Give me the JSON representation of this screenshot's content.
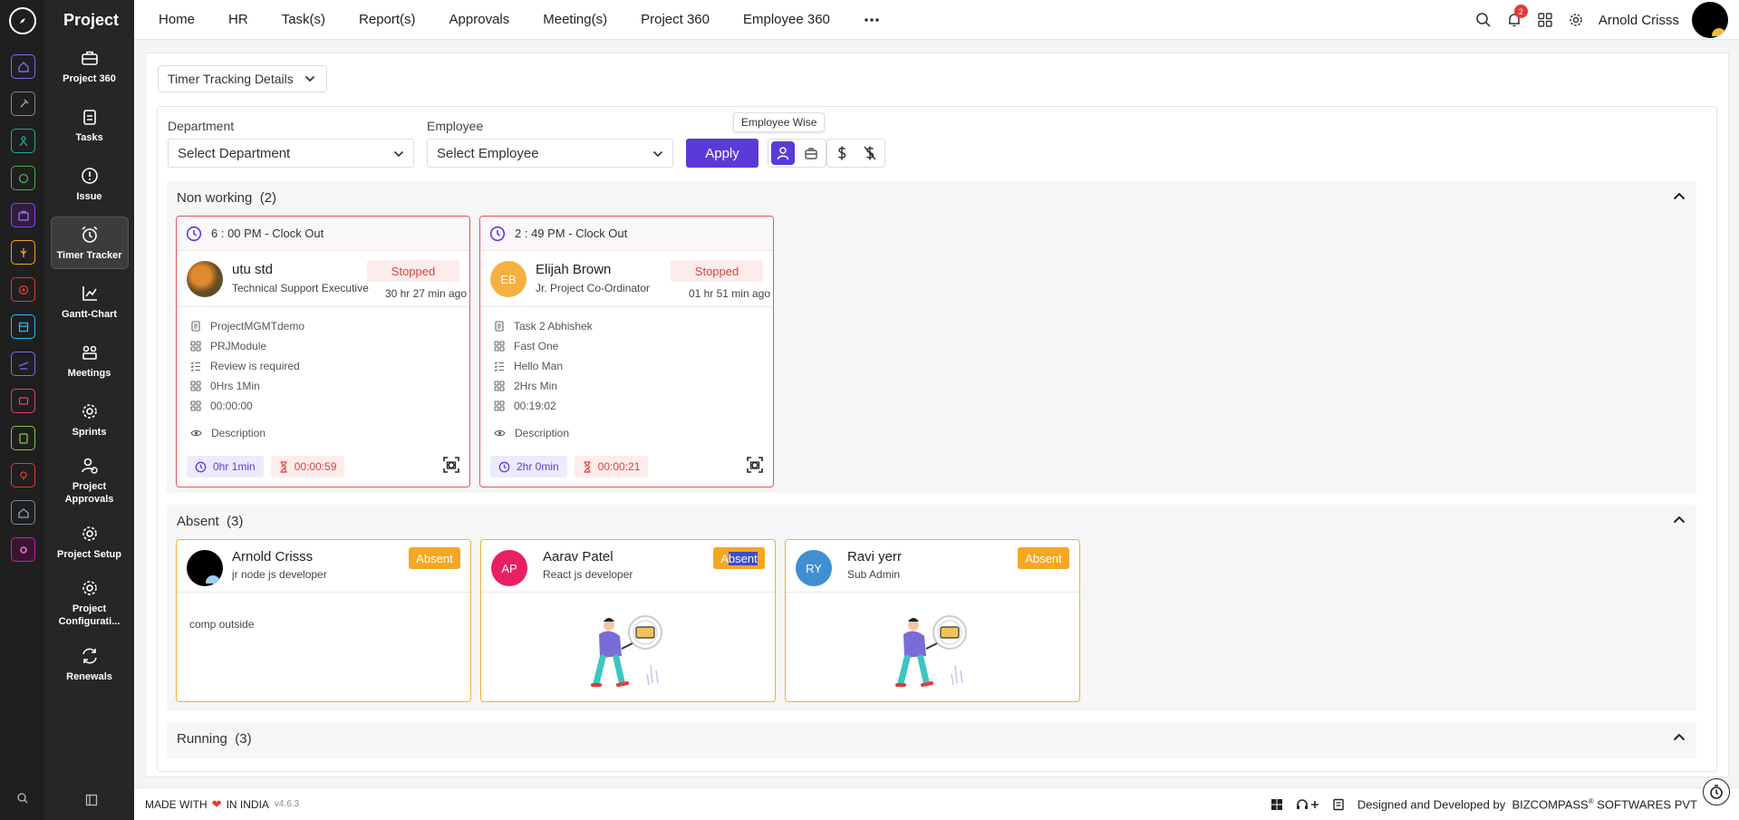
{
  "sidebar": {
    "brand": "Project",
    "items": [
      {
        "label": "Project 360",
        "icon": "briefcase-icon"
      },
      {
        "label": "Tasks",
        "icon": "clipboard-icon"
      },
      {
        "label": "Issue",
        "icon": "alert-circle-icon"
      },
      {
        "label": "Timer Tracker",
        "icon": "alarm-clock-icon",
        "active": true
      },
      {
        "label": "Gantt-Chart",
        "icon": "gantt-chart-icon"
      },
      {
        "label": "Meetings",
        "icon": "meetings-icon"
      },
      {
        "label": "Sprints",
        "icon": "gear-icon"
      },
      {
        "label": "Project Approvals",
        "icon": "user-check-icon"
      },
      {
        "label": "Project Setup",
        "icon": "gear-icon"
      },
      {
        "label": "Project Configurati...",
        "icon": "gear-icon"
      },
      {
        "label": "Renewals",
        "icon": "refresh-icon"
      }
    ]
  },
  "nav": {
    "items": [
      "Home",
      "HR",
      "Task(s)",
      "Report(s)",
      "Approvals",
      "Meeting(s)",
      "Project 360",
      "Employee 360"
    ]
  },
  "topbar": {
    "notification_count": "2",
    "user_name": "Arnold Crisss"
  },
  "main": {
    "view_dropdown": "Timer Tracking Details",
    "filters": {
      "department_label": "Department",
      "department_value": "Select Department",
      "employee_label": "Employee",
      "employee_value": "Select Employee",
      "apply_label": "Apply",
      "tooltip": "Employee Wise"
    },
    "sections": {
      "non_working": {
        "title": "Non working",
        "count": "(2)",
        "cards": [
          {
            "clock_out": "6 : 00 PM - Clock Out",
            "name": "utu std",
            "role": "Technical Support Executive",
            "status": "Stopped",
            "ago": "30 hr 27 min ago",
            "project": "ProjectMGMTdemo",
            "module": "PRJModule",
            "task": "Review is required",
            "estimate": "0Hrs 1Min",
            "logged": "00:00:00",
            "description": "Description",
            "total_time": "0hr 1min",
            "timer": "00:00:59"
          },
          {
            "clock_out": "2 : 49 PM - Clock Out",
            "initials": "EB",
            "name": "Elijah Brown",
            "role": "Jr. Project Co-Ordinator",
            "status": "Stopped",
            "ago": "01 hr 51 min ago",
            "project": "Task 2 Abhishek",
            "module": "Fast One",
            "task": "Hello Man",
            "estimate": "2Hrs Min",
            "logged": "00:19:02",
            "description": "Description",
            "total_time": "2hr 0min",
            "timer": "00:00:21"
          }
        ]
      },
      "absent": {
        "title": "Absent",
        "count": "(3)",
        "cards": [
          {
            "name": "Arnold Crisss",
            "role": "jr node js developer",
            "status": "Absent",
            "note": "comp outside"
          },
          {
            "initials": "AP",
            "name": "Aarav Patel",
            "role": "React js developer",
            "status_pre": "A",
            "status_hl": "bsent"
          },
          {
            "initials": "RY",
            "name": "Ravi yerr",
            "role": "Sub Admin",
            "status": "Absent"
          }
        ]
      },
      "running": {
        "title": "Running",
        "count": "(3)"
      }
    }
  },
  "footer": {
    "made_with": "MADE WITH",
    "in_india": "IN INDIA",
    "version": "v4.6.3",
    "credit_prefix": "Designed and Developed by",
    "company": "BIZCOMPASS",
    "reg": "®",
    "company_suffix": " SOFTWARES PVT"
  },
  "colors": {
    "accent": "#5b3bd6",
    "stopped_border": "#e15656",
    "absent_border": "#f0b042",
    "absent_badge": "#f5a623",
    "avatar_eb": "#f5b041",
    "avatar_ap": "#e91e63",
    "avatar_ry": "#3f8fd2"
  }
}
